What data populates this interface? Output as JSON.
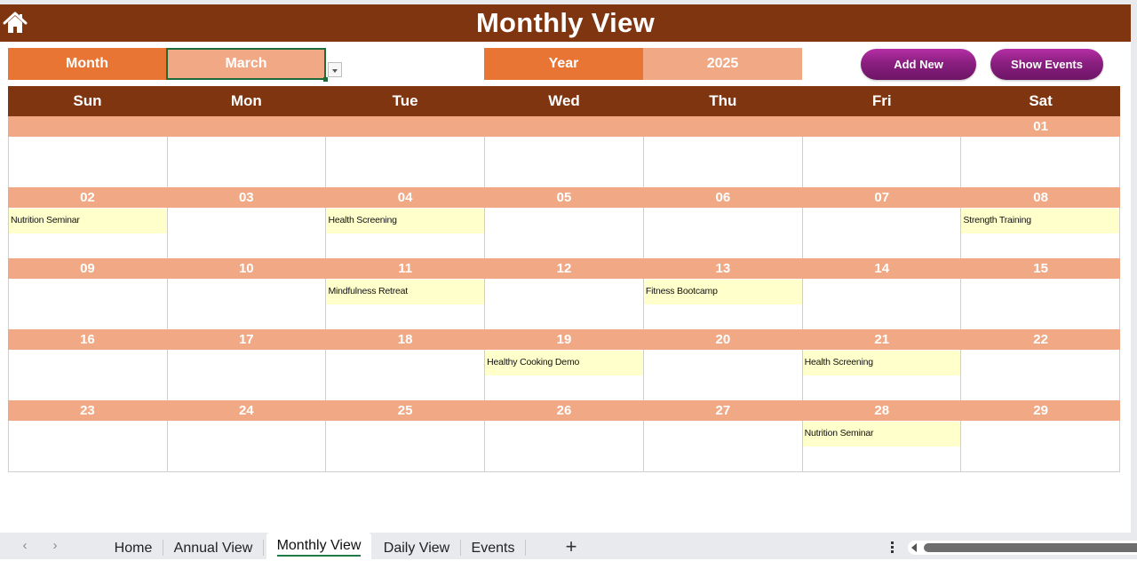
{
  "title": "Monthly View",
  "controls": {
    "month_label": "Month",
    "month_value": "March",
    "year_label": "Year",
    "year_value": "2025",
    "add_new_label": "Add New",
    "show_events_label": "Show Events"
  },
  "colors": {
    "title_bar": "#7f3510",
    "label_orange": "#e87534",
    "value_peach": "#f0a885",
    "event_yellow": "#ffffcc",
    "button_purple": "#8a1f80",
    "active_tab_underline": "#1e7b45"
  },
  "calendar": {
    "days_of_week": [
      "Sun",
      "Mon",
      "Tue",
      "Wed",
      "Thu",
      "Fri",
      "Sat"
    ],
    "weeks": [
      {
        "dates": [
          "",
          "",
          "",
          "",
          "",
          "",
          "01"
        ],
        "events": [
          "",
          "",
          "",
          "",
          "",
          "",
          ""
        ]
      },
      {
        "dates": [
          "02",
          "03",
          "04",
          "05",
          "06",
          "07",
          "08"
        ],
        "events": [
          "Nutrition Seminar",
          "",
          "Health Screening",
          "",
          "",
          "",
          "Strength Training"
        ]
      },
      {
        "dates": [
          "09",
          "10",
          "11",
          "12",
          "13",
          "14",
          "15"
        ],
        "events": [
          "",
          "",
          "Mindfulness Retreat",
          "",
          "Fitness Bootcamp",
          "",
          ""
        ]
      },
      {
        "dates": [
          "16",
          "17",
          "18",
          "19",
          "20",
          "21",
          "22"
        ],
        "events": [
          "",
          "",
          "",
          "Healthy Cooking Demo",
          "",
          "Health Screening",
          ""
        ]
      },
      {
        "dates": [
          "23",
          "24",
          "25",
          "26",
          "27",
          "28",
          "29"
        ],
        "events": [
          "",
          "",
          "",
          "",
          "",
          "Nutrition Seminar",
          ""
        ]
      }
    ]
  },
  "sheet_tabs": {
    "items": [
      "Home",
      "Annual View",
      "Monthly View",
      "Daily View",
      "Events"
    ],
    "active": "Monthly View",
    "add_label": "+",
    "prev_label": "‹",
    "next_label": "›"
  },
  "icons": {
    "home": "home-icon",
    "dropdown": "chevron-down-icon",
    "more": "more-vertical-icon",
    "scroll_left": "scroll-left-icon"
  }
}
